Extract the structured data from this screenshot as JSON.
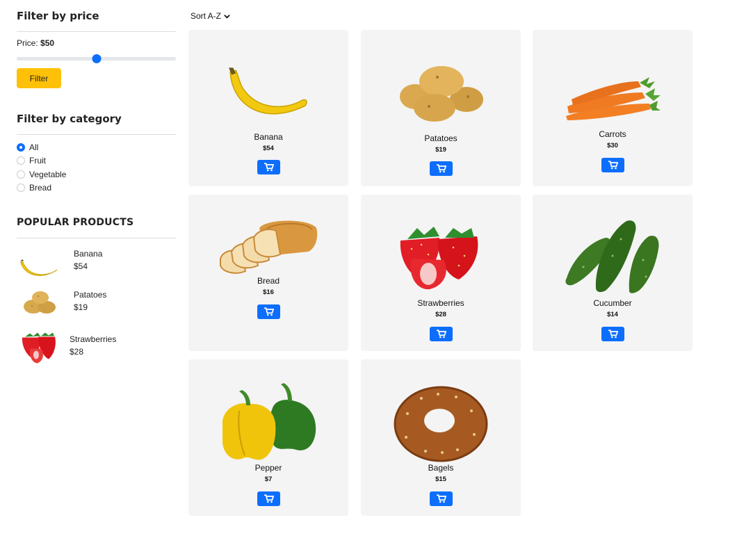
{
  "price_filter": {
    "heading": "Filter by price",
    "price_label": "Price:",
    "price_value": "$50",
    "slider_fraction": 0.5,
    "button_label": "Filter"
  },
  "category_filter": {
    "heading": "Filter by category",
    "options": [
      {
        "label": "All",
        "checked": true
      },
      {
        "label": "Fruit",
        "checked": false
      },
      {
        "label": "Vegetable",
        "checked": false
      },
      {
        "label": "Bread",
        "checked": false
      }
    ]
  },
  "popular": {
    "heading": "POPULAR PRODUCTS",
    "items": [
      {
        "name": "Banana",
        "price": "$54",
        "icon": "banana-icon"
      },
      {
        "name": "Patatoes",
        "price": "$19",
        "icon": "potatoes-icon"
      },
      {
        "name": "Strawberries",
        "price": "$28",
        "icon": "strawberries-icon"
      }
    ]
  },
  "sort": {
    "label": "Sort A-Z"
  },
  "products": [
    {
      "name": "Banana",
      "price": "$54",
      "icon": "banana-icon"
    },
    {
      "name": "Patatoes",
      "price": "$19",
      "icon": "potatoes-icon"
    },
    {
      "name": "Carrots",
      "price": "$30",
      "icon": "carrots-icon"
    },
    {
      "name": "Bread",
      "price": "$16",
      "icon": "bread-icon"
    },
    {
      "name": "Strawberries",
      "price": "$28",
      "icon": "strawberries-icon"
    },
    {
      "name": "Cucumber",
      "price": "$14",
      "icon": "cucumber-icon"
    },
    {
      "name": "Pepper",
      "price": "$7",
      "icon": "pepper-icon"
    },
    {
      "name": "Bagels",
      "price": "$15",
      "icon": "bagel-icon"
    }
  ],
  "colors": {
    "accent": "#0d6efd",
    "filter_button": "#ffc107",
    "card_bg": "#f4f4f4"
  }
}
